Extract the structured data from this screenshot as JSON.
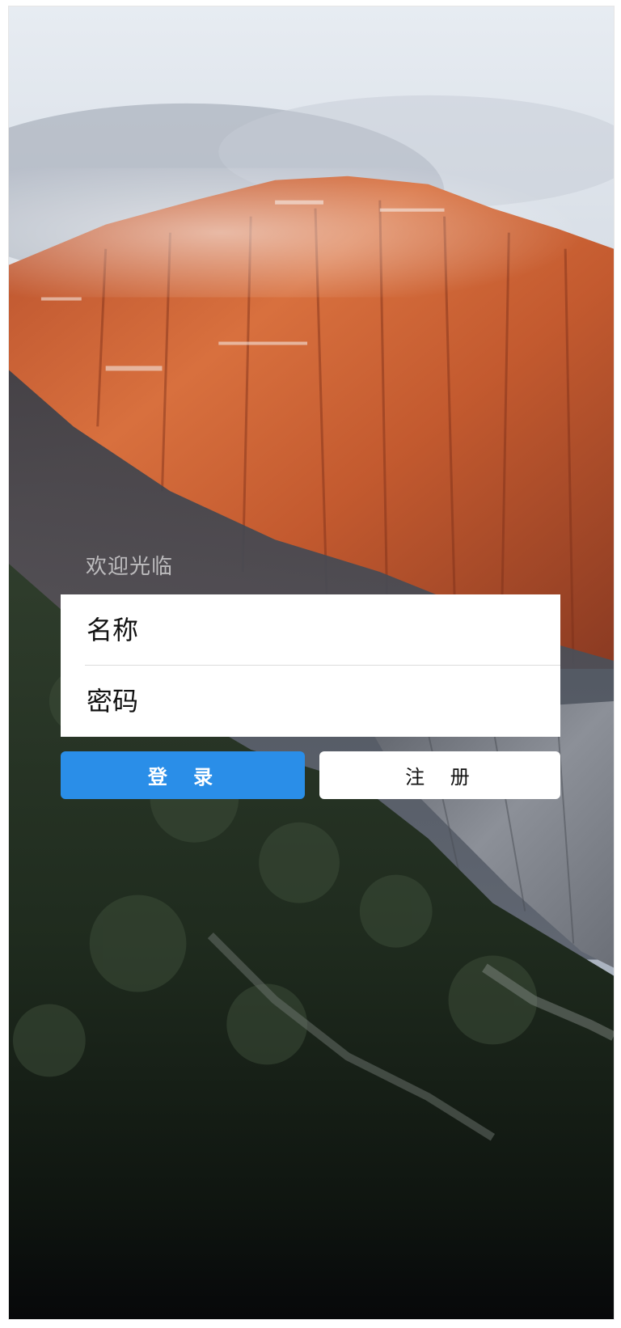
{
  "welcome_text": "欢迎光临",
  "form": {
    "name_placeholder": "名称",
    "password_placeholder": "密码"
  },
  "buttons": {
    "login_label": "登 录",
    "register_label": "注 册"
  },
  "colors": {
    "primary": "#2a8ee8",
    "card": "#ffffff"
  },
  "background": {
    "description_icon": "mountain-landscape-image"
  }
}
